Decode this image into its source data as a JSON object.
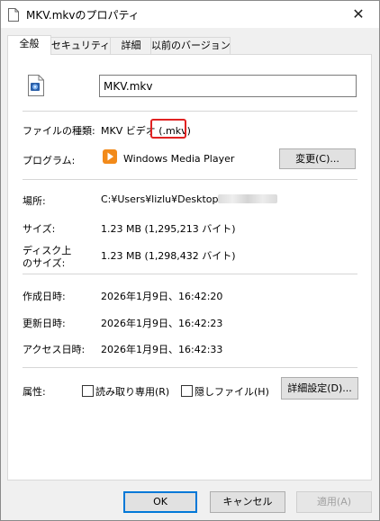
{
  "window": {
    "title": "MKV.mkvのプロパティ",
    "close_glyph": "✕"
  },
  "tabs": [
    {
      "label": "全般",
      "active": true
    },
    {
      "label": "セキュリティ",
      "active": false
    },
    {
      "label": "詳細",
      "active": false
    },
    {
      "label": "以前のバージョン",
      "active": false
    }
  ],
  "general": {
    "file_name": "MKV.mkv",
    "file_type_label": "ファイルの種類:",
    "file_type_prefix": "MKV ビデオ",
    "file_type_ext": "(.mkv)",
    "program_label": "プログラム:",
    "program_name": "Windows Media Player",
    "change_button": "変更(C)...",
    "location_label": "場所:",
    "location_value": "C:¥Users¥lizlu¥Desktop¥",
    "size_label": "サイズ:",
    "size_value": "1.23 MB (1,295,213 バイト)",
    "disk_size_label_1": "ディスク上",
    "disk_size_label_2": "のサイズ:",
    "disk_size_value": "1.23 MB (1,298,432 バイト)",
    "created_label": "作成日時:",
    "created_value": "2026年1月9日、16:42:20",
    "modified_label": "更新日時:",
    "modified_value": "2026年1月9日、16:42:23",
    "accessed_label": "アクセス日時:",
    "accessed_value": "2026年1月9日、16:42:33",
    "attributes_label": "属性:",
    "readonly_label": "読み取り専用(R)",
    "readonly_checked": false,
    "hidden_label": "隠しファイル(H)",
    "hidden_checked": false,
    "advanced_button": "詳細設定(D)..."
  },
  "footer": {
    "ok": "OK",
    "cancel": "キャンセル",
    "apply": "適用(A)"
  },
  "colors": {
    "highlight_border": "#e02222",
    "default_button_border": "#0078d7",
    "wmp_orange": "#f28a1a"
  },
  "icons": {
    "file": "media-file-icon",
    "program": "windows-media-player-icon"
  }
}
